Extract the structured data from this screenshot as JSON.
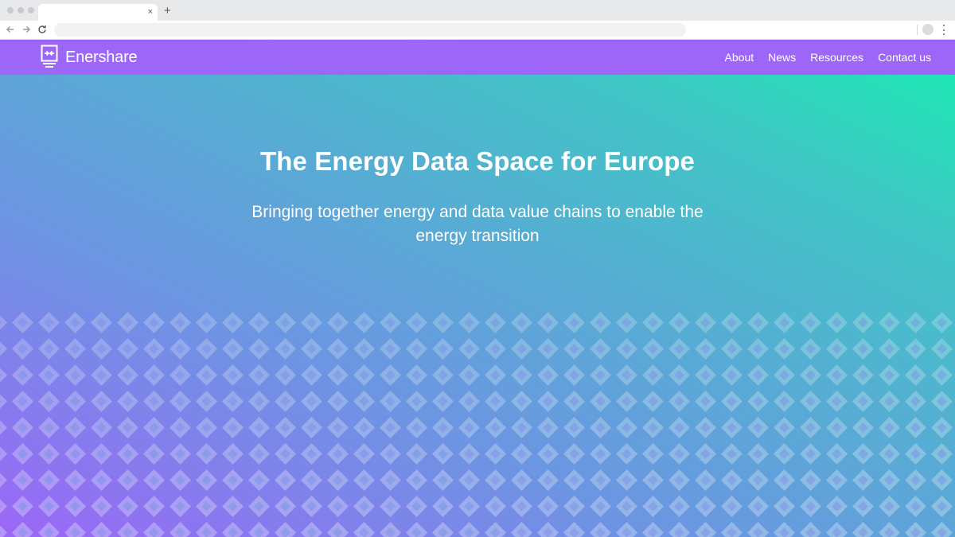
{
  "browser": {
    "tab_close": "×",
    "new_tab": "+"
  },
  "header": {
    "brand": "Enershare",
    "nav": [
      "About",
      "News",
      "Resources",
      "Contact us"
    ]
  },
  "hero": {
    "title": "The Energy Data Space for Europe",
    "subtitle": "Bringing together energy and data value chains to enable the energy transition"
  },
  "colors": {
    "header": "#9c67f7",
    "gradient_start": "#9b67f7",
    "gradient_end": "#1ee6b4",
    "text": "#ffffff"
  }
}
